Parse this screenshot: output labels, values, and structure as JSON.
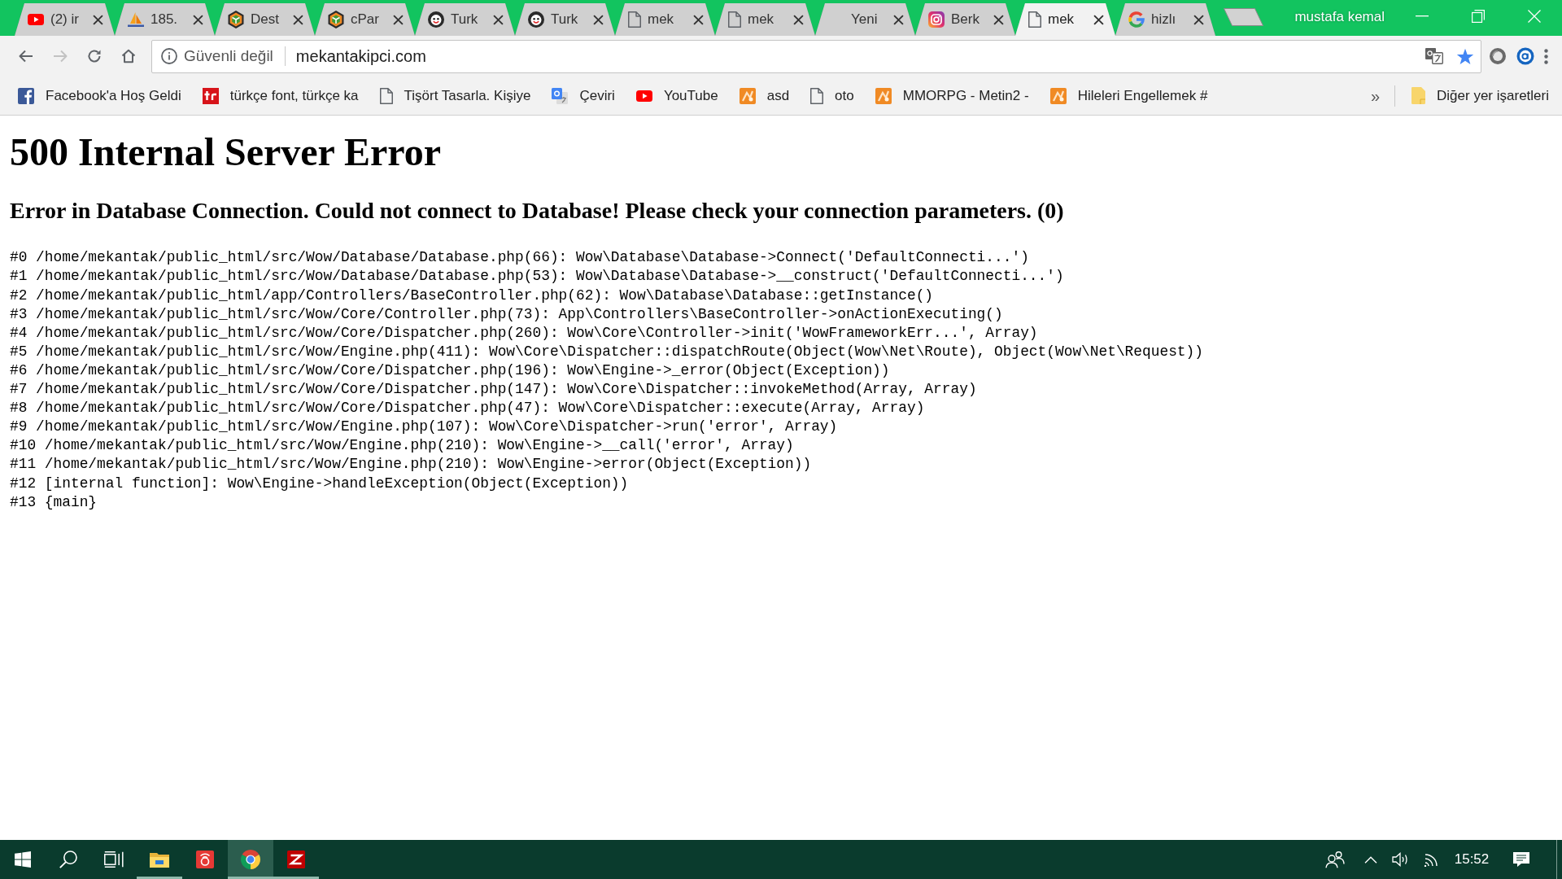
{
  "window": {
    "profile_name": "mustafa kemal"
  },
  "tabs": [
    {
      "title": "(2) ir",
      "kind": "youtube",
      "selected": false
    },
    {
      "title": "185.",
      "kind": "sails",
      "selected": false
    },
    {
      "title": "Dest",
      "kind": "hexagon",
      "selected": false
    },
    {
      "title": "cPar",
      "kind": "hexagon",
      "selected": false
    },
    {
      "title": "Turk",
      "kind": "face",
      "selected": false
    },
    {
      "title": "Turk",
      "kind": "face",
      "selected": false
    },
    {
      "title": "mek",
      "kind": "page",
      "selected": false
    },
    {
      "title": "mek",
      "kind": "page",
      "selected": false
    },
    {
      "title": "Yeni",
      "kind": "none",
      "selected": false
    },
    {
      "title": "Berk",
      "kind": "instagram",
      "selected": false
    },
    {
      "title": "mek",
      "kind": "page",
      "selected": true
    },
    {
      "title": "hizlı",
      "kind": "google",
      "selected": false
    }
  ],
  "toolbar": {
    "nav_buttons": [
      {
        "kind": "back",
        "disabled": false
      },
      {
        "kind": "forward",
        "disabled": true
      },
      {
        "kind": "reload",
        "disabled": false
      },
      {
        "kind": "home",
        "disabled": false
      }
    ],
    "address_bar": {
      "security_label": "Güvenli değil",
      "url": "mekantakipci.com",
      "bookmarked": true
    }
  },
  "bookmarks": {
    "items": [
      {
        "title": "Facebook'a Hoş Geldi",
        "kind": "facebook"
      },
      {
        "title": "türkçe font, türkçe ka",
        "kind": "tr"
      },
      {
        "title": "Tişört Tasarla. Kişiye",
        "kind": "page"
      },
      {
        "title": "Çeviri",
        "kind": "translate"
      },
      {
        "title": "YouTube",
        "kind": "youtube"
      },
      {
        "title": "asd",
        "kind": "game"
      },
      {
        "title": "oto",
        "kind": "page"
      },
      {
        "title": "MMORPG - Metin2 -",
        "kind": "game"
      },
      {
        "title": "Hileleri Engellemek #",
        "kind": "game"
      }
    ],
    "overflow": "»",
    "other": "Diğer yer işaretleri"
  },
  "page": {
    "heading": "500 Internal Server Error",
    "message": "Error in Database Connection. Could not connect to Database! Please check your connection parameters. (0)",
    "trace": [
      "#0 /home/mekantak/public_html/src/Wow/Database/Database.php(66): Wow\\Database\\Database->Connect('DefaultConnecti...')",
      "#1 /home/mekantak/public_html/src/Wow/Database/Database.php(53): Wow\\Database\\Database->__construct('DefaultConnecti...')",
      "#2 /home/mekantak/public_html/app/Controllers/BaseController.php(62): Wow\\Database\\Database::getInstance()",
      "#3 /home/mekantak/public_html/src/Wow/Core/Controller.php(73): App\\Controllers\\BaseController->onActionExecuting()",
      "#4 /home/mekantak/public_html/src/Wow/Core/Dispatcher.php(260): Wow\\Core\\Controller->init('WowFrameworkErr...', Array)",
      "#5 /home/mekantak/public_html/src/Wow/Engine.php(411): Wow\\Core\\Dispatcher::dispatchRoute(Object(Wow\\Net\\Route), Object(Wow\\Net\\Request))",
      "#6 /home/mekantak/public_html/src/Wow/Core/Dispatcher.php(196): Wow\\Engine->_error(Object(Exception))",
      "#7 /home/mekantak/public_html/src/Wow/Core/Dispatcher.php(147): Wow\\Core\\Dispatcher::invokeMethod(Array, Array)",
      "#8 /home/mekantak/public_html/src/Wow/Core/Dispatcher.php(47): Wow\\Core\\Dispatcher::execute(Array, Array)",
      "#9 /home/mekantak/public_html/src/Wow/Engine.php(107): Wow\\Core\\Dispatcher->run('error', Array)",
      "#10 /home/mekantak/public_html/src/Wow/Engine.php(210): Wow\\Engine->__call('error', Array)",
      "#11 /home/mekantak/public_html/src/Wow/Engine.php(210): Wow\\Engine->error(Object(Exception))",
      "#12 [internal function]: Wow\\Engine->handleException(Object(Exception))",
      "#13 {main}"
    ]
  },
  "taskbar": {
    "apps": [
      {
        "kind": "explorer",
        "running": true,
        "active": false
      },
      {
        "kind": "app",
        "running": false,
        "active": false
      },
      {
        "kind": "chrome",
        "running": true,
        "active": true
      },
      {
        "kind": "filezilla",
        "running": true,
        "active": false
      }
    ],
    "clock": "15:52"
  }
}
